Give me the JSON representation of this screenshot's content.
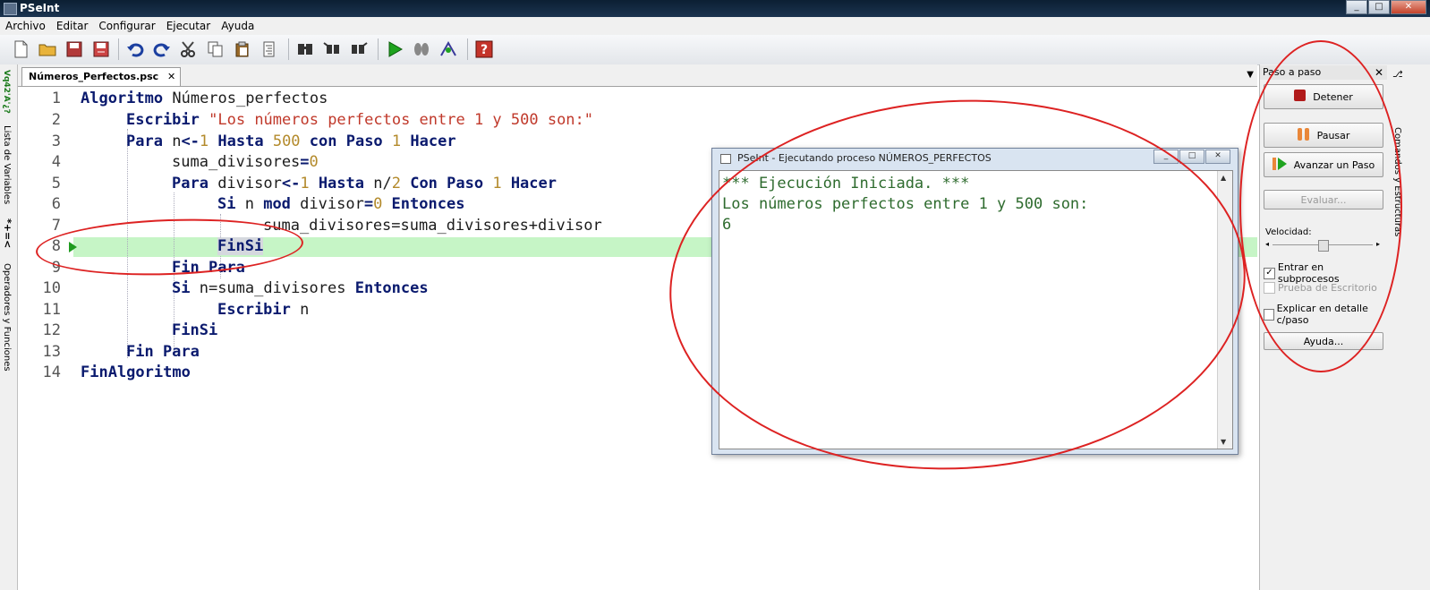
{
  "window": {
    "title": "PSeInt",
    "controls": [
      "_",
      "□",
      "✕"
    ]
  },
  "menu": [
    "Archivo",
    "Editar",
    "Configurar",
    "Ejecutar",
    "Ayuda"
  ],
  "toolbar_icons": [
    "new-file-icon",
    "open-folder-icon",
    "save-icon",
    "save-as-icon",
    "undo-icon",
    "redo-icon",
    "cut-icon",
    "copy-icon",
    "paste-icon",
    "indent-icon",
    "find-icon",
    "find-prev-icon",
    "find-next-icon",
    "run-icon",
    "step-icon",
    "debug-icon",
    "help-icon"
  ],
  "left_strip": {
    "variables_label": "Lista de Variables",
    "operators_label": "Operadores y Funciones",
    "var_icon_text": "Vq42'A'¿?",
    "ops_icon_text": "*+=<"
  },
  "tab": {
    "label": "Números_Perfectos.psc",
    "close": "✕"
  },
  "editor": {
    "line_numbers": [
      "1",
      "2",
      "3",
      "4",
      "5",
      "6",
      "7",
      "8",
      "9",
      "10",
      "11",
      "12",
      "13",
      "14"
    ],
    "lines": [
      {
        "k1": "Algoritmo",
        "t1": " Números_perfectos"
      },
      {
        "k1": "Escribir",
        "s1": "\"Los números perfectos entre 1 y 500 son:\""
      },
      {
        "k1": "Para",
        "t1": " n",
        "k2": "<-",
        "n1": "1",
        "k3": " Hasta ",
        "n2": "500",
        "k4": " con Paso ",
        "n3": "1",
        "k5": " Hacer"
      },
      {
        "t1": "suma_divisores",
        "k1": "=",
        "n1": "0"
      },
      {
        "k1": "Para",
        "t1": " divisor",
        "k2": "<-",
        "n1": "1",
        "k3": " Hasta ",
        "t2": "n/",
        "n2": "2",
        "k4": " Con Paso ",
        "n3": "1",
        "k5": " Hacer"
      },
      {
        "k1": "Si",
        "t1": " n ",
        "k2": "mod",
        "t2": " divisor",
        "k3": "=",
        "n1": "0",
        "k4": " Entonces"
      },
      {
        "t1": "suma_divisores=suma_divisores+divisor"
      },
      {
        "k1": "FinSi"
      },
      {
        "k1": "Fin Para"
      },
      {
        "k1": "Si",
        "t1": " n=suma_divisores ",
        "k2": "Entonces"
      },
      {
        "k1": "Escribir",
        "t1": " n"
      },
      {
        "k1": "FinSi"
      },
      {
        "k1": "Fin Para"
      },
      {
        "k1": "FinAlgoritmo"
      }
    ]
  },
  "run_window": {
    "title": "PSeInt - Ejecutando proceso NÚMEROS_PERFECTOS",
    "output": [
      "*** Ejecución Iniciada. ***",
      "Los números perfectos entre 1 y 500 son:",
      "6"
    ],
    "controls": [
      "_",
      "□",
      "✕"
    ]
  },
  "step_panel": {
    "title": "Paso a paso",
    "close": "✕",
    "stop": "Detener",
    "pause": "Pausar",
    "step": "Avanzar un Paso",
    "evaluate": "Evaluar...",
    "speed_label": "Velocidad:",
    "speed_value": 0.5,
    "enter_subprocesses": "Entrar en subprocesos",
    "desk_check": "Prueba de Escritorio",
    "explain_detail": "Explicar en detalle c/paso",
    "help": "Ayuda...",
    "checked_mark": "✓"
  },
  "right_strip": {
    "label": "Comandos y Estructuras"
  },
  "colors": {
    "keyword": "#0a1a6e",
    "number": "#b38a2b",
    "string": "#c0392b",
    "console_text": "#2e6b2e",
    "current_line": "#c6f5c6",
    "annotation": "#dd2222"
  }
}
